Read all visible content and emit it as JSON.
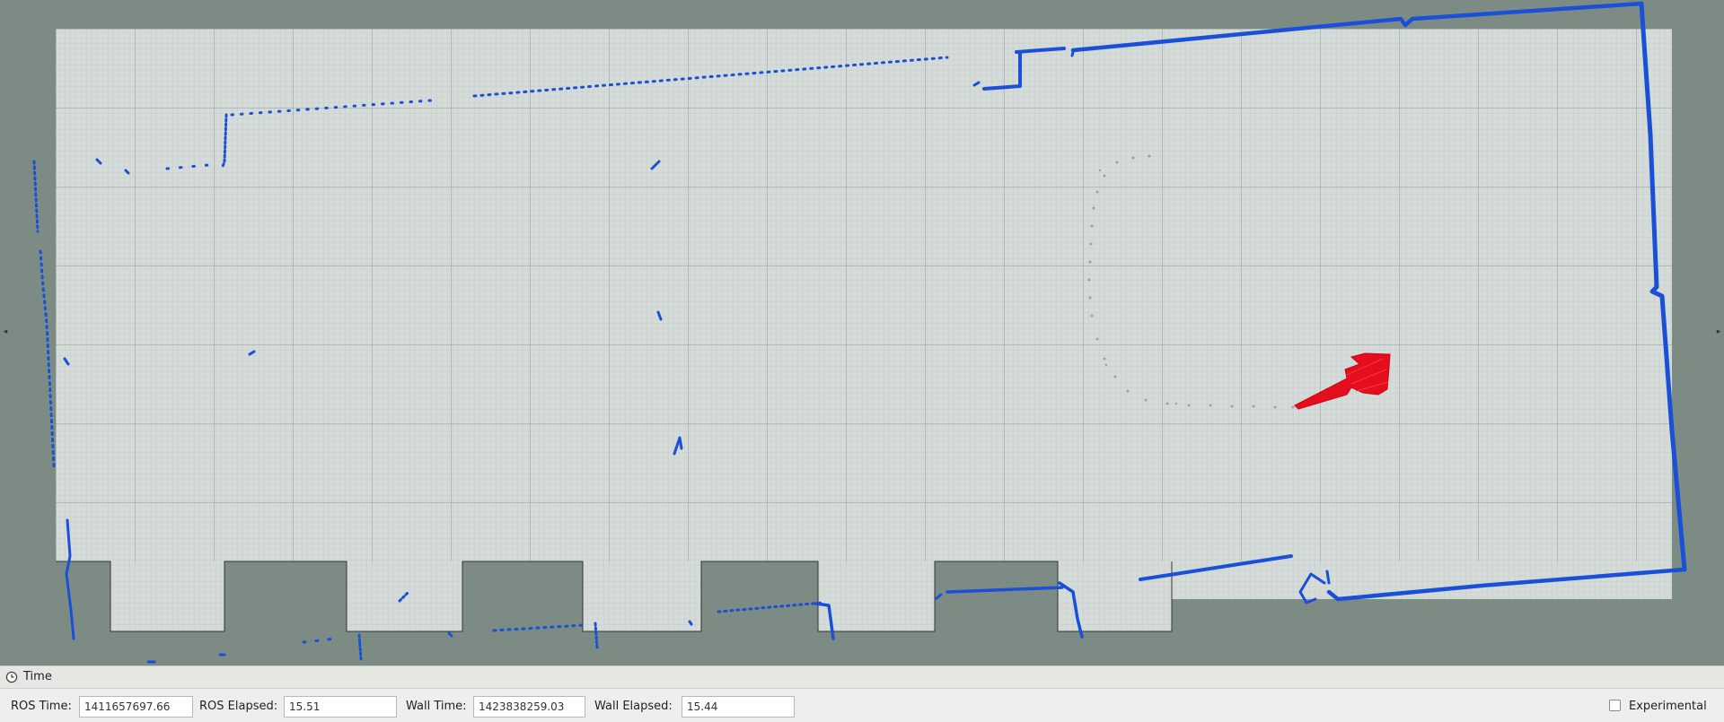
{
  "viewer": {
    "background_color": "#7c8c85",
    "map_free_color": "#d5dbd8",
    "grid_line_color": "#8f9b96",
    "scan_color": "#1a4fd8",
    "trail_color": "#9aa39f",
    "pose_color": "#e60d1e"
  },
  "time_panel": {
    "title": "Time",
    "icon": "clock-icon",
    "ros_time": {
      "label": "ROS Time:",
      "value": "1411657697.66"
    },
    "ros_elapsed": {
      "label": "ROS Elapsed:",
      "value": "15.51"
    },
    "wall_time": {
      "label": "Wall Time:",
      "value": "1423838259.03"
    },
    "wall_elapsed": {
      "label": "Wall Elapsed:",
      "value": "15.44"
    },
    "experimental": {
      "label": "Experimental",
      "checked": false
    }
  }
}
